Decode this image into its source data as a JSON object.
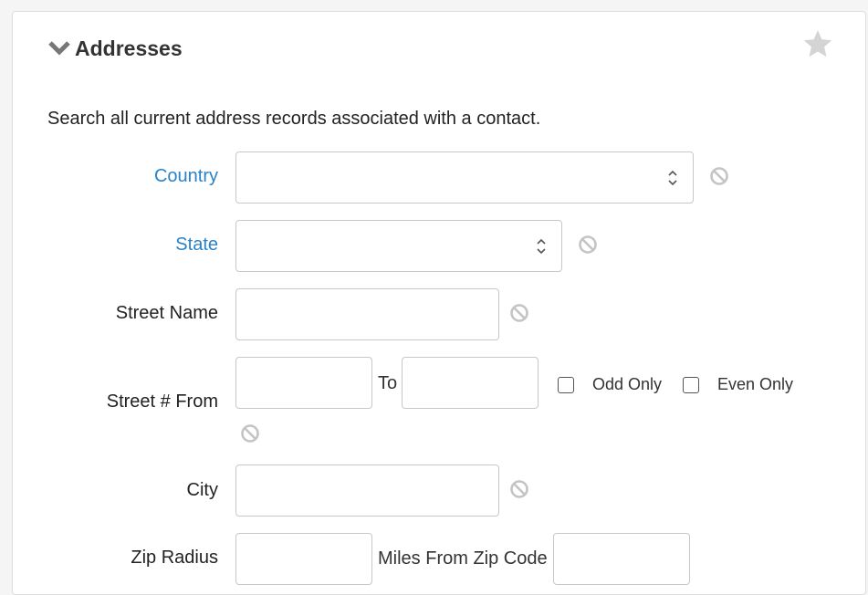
{
  "section": {
    "title": "Addresses",
    "description": "Search all current address records associated with a contact."
  },
  "fields": {
    "country": {
      "label": "Country",
      "value": ""
    },
    "state": {
      "label": "State",
      "value": ""
    },
    "street_name": {
      "label": "Street Name",
      "value": ""
    },
    "street_number": {
      "label": "Street # From",
      "from_value": "",
      "to_label": "To",
      "to_value": "",
      "odd_only_label": "Odd Only",
      "odd_only_checked": false,
      "even_only_label": "Even Only",
      "even_only_checked": false
    },
    "city": {
      "label": "City",
      "value": ""
    },
    "zip_radius": {
      "label": "Zip Radius",
      "miles_value": "",
      "miles_from_label": "Miles From Zip Code",
      "zip_value": ""
    }
  },
  "colors": {
    "link_label": "#2a82c8",
    "icon_gray": "#c4c4c4"
  },
  "icons": {
    "collapse": "chevron-down-icon",
    "favorite": "star-icon",
    "clear": "clear-icon"
  }
}
